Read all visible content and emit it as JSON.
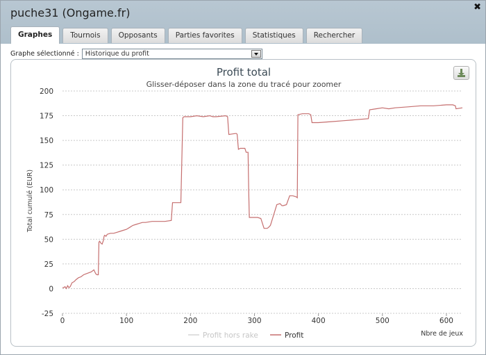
{
  "window": {
    "title": "puche31 (Ongame.fr)",
    "close_glyph": "✖",
    "tabs": [
      {
        "label": "Graphes",
        "active": true
      },
      {
        "label": "Tournois",
        "active": false
      },
      {
        "label": "Opposants",
        "active": false
      },
      {
        "label": "Parties favorites",
        "active": false
      },
      {
        "label": "Statistiques",
        "active": false
      },
      {
        "label": "Rechercher",
        "active": false
      }
    ]
  },
  "selector": {
    "label": "Graphe sélectionné :",
    "value": "Historique du profit"
  },
  "icons": {
    "download": "download-icon",
    "dropdown": "chevron-down-icon",
    "close": "close-icon"
  },
  "colors": {
    "profit": "#c56e6e",
    "profit_hors_rake": "#d6d6d6",
    "grid": "#c8c8c8",
    "title": "#3b4a55"
  },
  "chart_data": {
    "type": "line",
    "title": "Profit total",
    "subtitle": "Glisser-déposer dans la zone du tracé pour zoomer",
    "ylabel": "Total cumulé (EUR)",
    "xlabel": "Nbre de jeux",
    "ylim": [
      -25,
      200
    ],
    "xlim": [
      0,
      625
    ],
    "xticks": [
      0,
      100,
      200,
      300,
      400,
      500,
      600
    ],
    "yticks": [
      -25,
      0,
      25,
      50,
      75,
      100,
      125,
      150,
      175,
      200
    ],
    "grid": true,
    "legend_position": "bottom-center",
    "series": [
      {
        "name": "Profit hors rake",
        "values": []
      },
      {
        "name": "Profit",
        "x": [
          0,
          2,
          4,
          6,
          8,
          10,
          12,
          15,
          18,
          21,
          25,
          29,
          33,
          37,
          41,
          45,
          49,
          52,
          54,
          56,
          57,
          58,
          60,
          62,
          64,
          65,
          66,
          68,
          70,
          75,
          80,
          85,
          90,
          95,
          100,
          105,
          110,
          115,
          120,
          125,
          130,
          140,
          150,
          160,
          170,
          172,
          173,
          185,
          188,
          190,
          200,
          210,
          220,
          230,
          235,
          240,
          255,
          258,
          260,
          270,
          272,
          273,
          275,
          278,
          285,
          287,
          290,
          291,
          292,
          300,
          305,
          310,
          315,
          320,
          322,
          325,
          335,
          340,
          343,
          345,
          350,
          355,
          360,
          365,
          367,
          368,
          375,
          385,
          388,
          390,
          400,
          420,
          440,
          460,
          478,
          480,
          490,
          500,
          510,
          520,
          540,
          560,
          580,
          600,
          610,
          614,
          615,
          625
        ],
        "values": [
          1,
          1,
          2,
          0,
          3,
          1,
          2,
          6,
          7,
          9,
          11,
          12,
          14,
          15,
          16,
          17,
          19,
          15,
          14,
          14,
          47,
          48,
          46,
          45,
          49,
          53,
          54,
          53,
          55,
          56,
          56,
          57,
          58,
          59,
          60,
          62,
          64,
          65,
          66,
          67,
          67,
          68,
          68,
          68,
          69,
          87,
          87,
          87,
          173,
          174,
          174,
          175,
          174,
          175,
          174,
          174,
          175,
          174,
          156,
          157,
          157,
          156,
          141,
          142,
          142,
          138,
          138,
          100,
          72,
          72,
          72,
          71,
          61,
          61,
          62,
          64,
          85,
          86,
          84,
          84,
          85,
          94,
          94,
          93,
          92,
          176,
          177,
          177,
          176,
          168,
          168,
          169,
          170,
          171,
          172,
          181,
          182,
          183,
          182,
          183,
          184,
          185,
          185,
          186,
          186,
          185,
          182,
          183
        ]
      }
    ]
  }
}
